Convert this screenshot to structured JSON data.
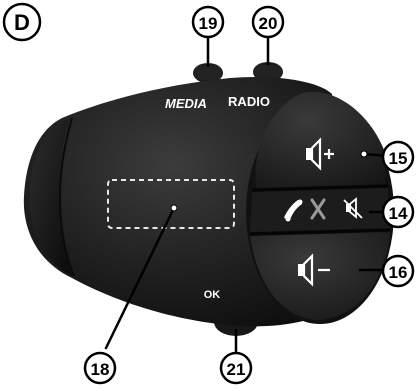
{
  "figure": {
    "panel_letter": "D",
    "control_labels": {
      "media": "MEDIA",
      "radio": "RADIO",
      "ok": "OK"
    },
    "callouts": {
      "c15": "15",
      "c14": "14",
      "c16": "16",
      "c18": "18",
      "c19": "19",
      "c20": "20",
      "c21": "21"
    },
    "colors": {
      "body_dark": "#1a1a1a",
      "body_mid": "#2a2a2a",
      "highlight": "#4a4a4a",
      "callout_fill": "#ffffff",
      "text_light": "#ffffff",
      "ink": "#000000"
    },
    "icons": [
      "volume-up-icon",
      "phone-pickup-icon",
      "phone-hangup-icon",
      "mute-icon",
      "volume-down-icon"
    ]
  }
}
